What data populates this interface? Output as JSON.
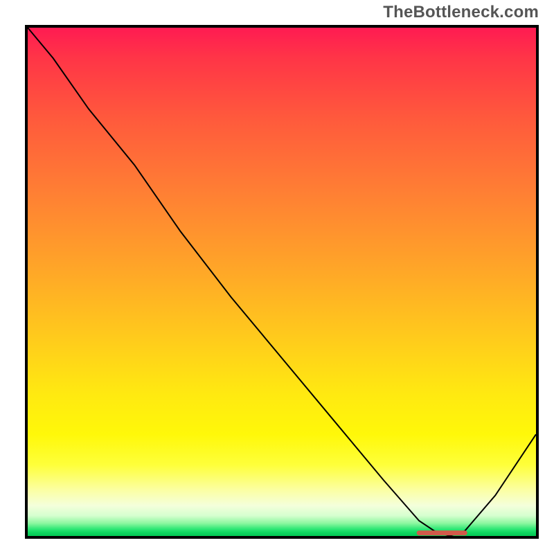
{
  "watermark_text": "TheBottleneck.com",
  "chart_data": {
    "type": "line",
    "title": "",
    "xlabel": "",
    "ylabel": "",
    "xlim": [
      0,
      100
    ],
    "ylim": [
      0,
      100
    ],
    "series": [
      {
        "name": "bottleneck-curve",
        "x": [
          0,
          5,
          12,
          21,
          30,
          40,
          50,
          60,
          70,
          77,
          80,
          83,
          86,
          92,
          100
        ],
        "values": [
          100,
          94,
          84,
          73,
          60,
          47,
          35,
          23,
          11,
          3,
          1,
          0,
          1,
          8,
          20
        ]
      }
    ],
    "marker": {
      "name": "optimal-range",
      "x_start": 77,
      "x_end": 86,
      "y": 0.6,
      "color": "#d15a4a",
      "thickness": 7
    },
    "colors": {
      "curve": "#000000",
      "frame": "#000000"
    }
  }
}
